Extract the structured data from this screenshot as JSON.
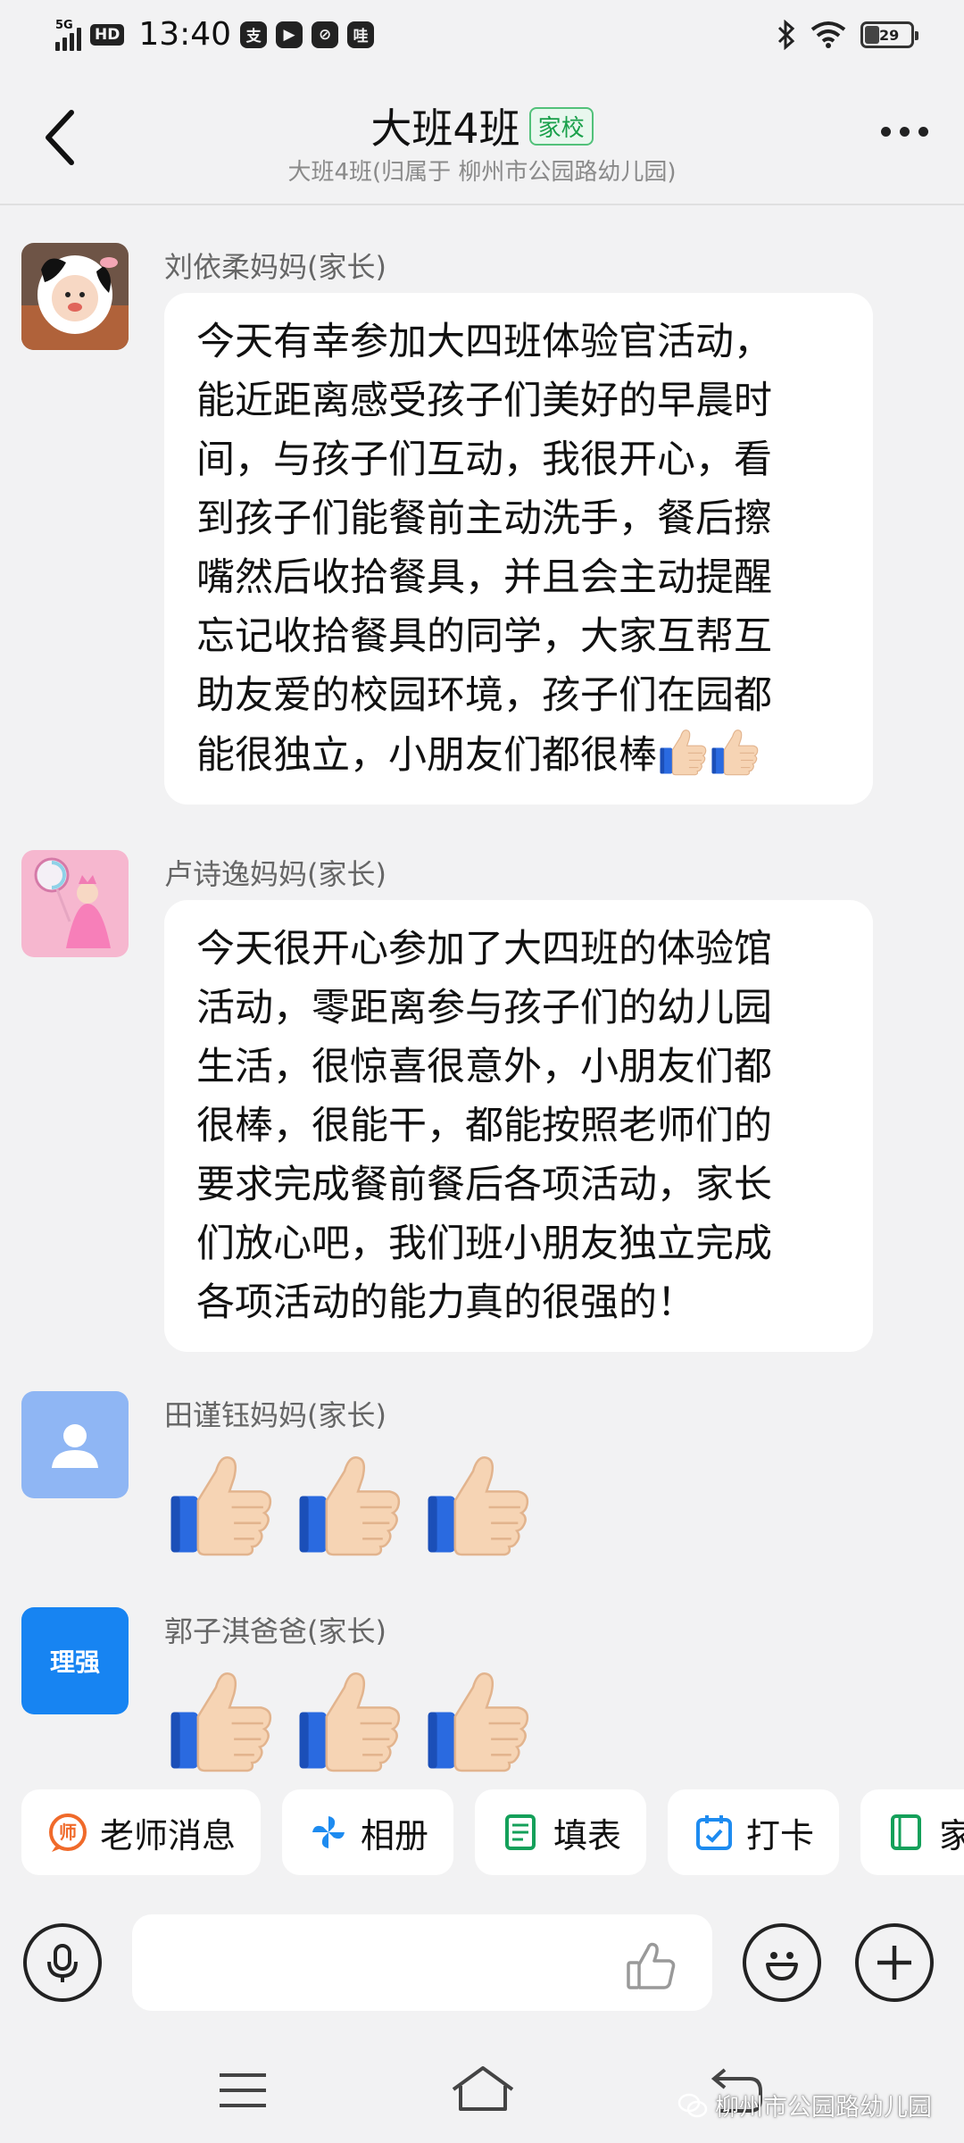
{
  "status_bar": {
    "network": "5G",
    "hd": "HD",
    "time": "13:40",
    "app_icons": [
      "支",
      "▶",
      "⊘",
      "哇"
    ],
    "battery": "29"
  },
  "header": {
    "title": "大班4班",
    "tag": "家校",
    "subtitle": "大班4班(归属于 柳州市公园路幼儿园)"
  },
  "messages": [
    {
      "sender": "刘依柔妈妈(家长)",
      "lines": [
        "今天有幸参加大四班体验官活动，",
        "能近距离感受孩子们美好的早晨时",
        "间，与孩子们互动，我很开心，看",
        "到孩子们能餐前主动洗手，餐后擦",
        "嘴然后收拾餐具，并且会主动提醒",
        "忘记收拾餐具的同学，大家互帮互",
        "助友爱的校园环境，孩子们在园都",
        "能很独立，小朋友们都很棒"
      ]
    },
    {
      "sender": "卢诗逸妈妈(家长)",
      "lines": [
        "今天很开心参加了大四班的体验馆",
        "活动，零距离参与孩子们的幼儿园",
        "生活，很惊喜很意外，小朋友们都",
        "很棒，很能干，都能按照老师们的",
        "要求完成餐前餐后各项活动，家长",
        "们放心吧，我们班小朋友独立完成",
        "各项活动的能力真的很强的！"
      ]
    },
    {
      "sender": "田谨钰妈妈(家长)"
    },
    {
      "sender": "郭子淇爸爸(家长)",
      "avatar_text": "理强"
    }
  ],
  "quick_actions": [
    {
      "label": "老师消息",
      "icon": "teacher-icon"
    },
    {
      "label": "相册",
      "icon": "pinwheel-icon"
    },
    {
      "label": "填表",
      "icon": "form-icon"
    },
    {
      "label": "打卡",
      "icon": "checkin-icon"
    },
    {
      "label": "家",
      "icon": "notebook-icon"
    }
  ],
  "input": {
    "placeholder": ""
  },
  "watermark": "柳州市公园路幼儿园"
}
